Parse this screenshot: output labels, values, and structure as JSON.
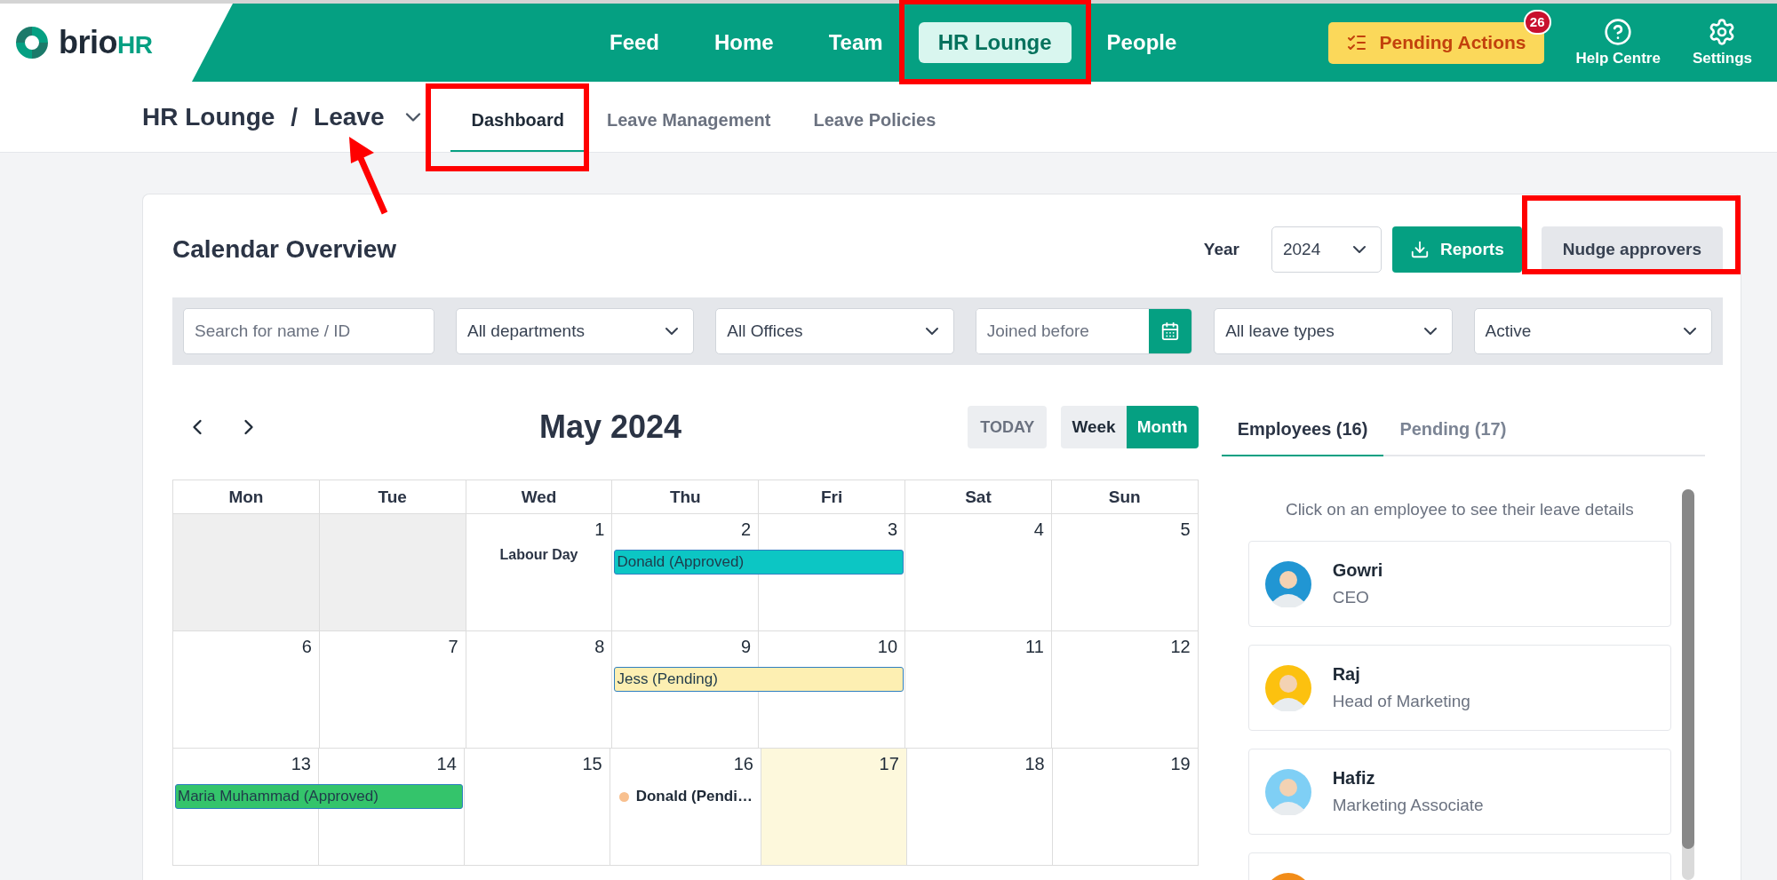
{
  "brand": {
    "name": "brio",
    "suffix": "HR"
  },
  "nav": [
    {
      "label": "Feed",
      "selected": false,
      "highlighted": false
    },
    {
      "label": "Home",
      "selected": false,
      "highlighted": false
    },
    {
      "label": "Team",
      "selected": false,
      "highlighted": false
    },
    {
      "label": "HR Lounge",
      "selected": true,
      "highlighted": true
    },
    {
      "label": "People",
      "selected": false,
      "highlighted": false
    }
  ],
  "pending_actions": {
    "label": "Pending Actions",
    "badge": "26"
  },
  "utilities": [
    {
      "label": "Help Centre",
      "kind": "help"
    },
    {
      "label": "Settings",
      "kind": "settings"
    }
  ],
  "breadcrumb": {
    "section": "HR Lounge",
    "separator": "/",
    "page": "Leave",
    "pointed_at": true
  },
  "subtabs": [
    {
      "label": "Dashboard",
      "selected": true,
      "highlighted": true
    },
    {
      "label": "Leave Management",
      "selected": false,
      "highlighted": false
    },
    {
      "label": "Leave Policies",
      "selected": false,
      "highlighted": false
    }
  ],
  "calendar_overview": {
    "title": "Calendar Overview",
    "year_label": "Year",
    "year": "2024",
    "reports_button": "Reports",
    "nudge_button": {
      "label": "Nudge approvers",
      "highlighted": true
    },
    "filters": [
      {
        "kind": "text",
        "placeholder": "Search for name / ID"
      },
      {
        "kind": "select",
        "value": "All departments"
      },
      {
        "kind": "select",
        "value": "All Offices"
      },
      {
        "kind": "date",
        "placeholder": "Joined before"
      },
      {
        "kind": "select",
        "value": "All leave types"
      },
      {
        "kind": "select",
        "value": "Active"
      }
    ],
    "month_title": "May 2024",
    "today_button": "TODAY",
    "views": [
      {
        "label": "Week",
        "selected": false
      },
      {
        "label": "Month",
        "selected": true
      }
    ],
    "weekdays": [
      "Mon",
      "Tue",
      "Wed",
      "Thu",
      "Fri",
      "Sat",
      "Sun"
    ],
    "weeks": [
      {
        "days": [
          {
            "outside": true,
            "today": false
          },
          {
            "outside": true,
            "today": false
          },
          {
            "number": "1",
            "outside": false,
            "today": false,
            "holiday": "Labour Day"
          },
          {
            "number": "2",
            "outside": false,
            "today": false,
            "event": {
              "kind": "bar",
              "label": "Donald (Approved)",
              "color": "#0cc6c4"
            }
          },
          {
            "number": "3",
            "outside": false,
            "today": false,
            "event_continues": true
          },
          {
            "number": "4",
            "outside": false,
            "today": false
          },
          {
            "number": "5",
            "outside": false,
            "today": false
          }
        ]
      },
      {
        "days": [
          {
            "number": "6",
            "outside": false,
            "today": false
          },
          {
            "number": "7",
            "outside": false,
            "today": false
          },
          {
            "number": "8",
            "outside": false,
            "today": false
          },
          {
            "number": "9",
            "outside": false,
            "today": false,
            "event": {
              "kind": "bar",
              "label": "Jess (Pending)",
              "color": "#fdefb2"
            }
          },
          {
            "number": "10",
            "outside": false,
            "today": false,
            "event_continues": true
          },
          {
            "number": "11",
            "outside": false,
            "today": false
          },
          {
            "number": "12",
            "outside": false,
            "today": false
          }
        ]
      },
      {
        "days": [
          {
            "number": "13",
            "outside": false,
            "today": false,
            "event": {
              "kind": "bar",
              "label": "Maria Muhammad (Approved)",
              "color": "#34c46b"
            }
          },
          {
            "number": "14",
            "outside": false,
            "today": false,
            "event_continues": true
          },
          {
            "number": "15",
            "outside": false,
            "today": false
          },
          {
            "number": "16",
            "outside": false,
            "today": false,
            "event": {
              "kind": "dot",
              "label": "Donald (Pendi…",
              "color": "#f8c08f"
            }
          },
          {
            "number": "17",
            "outside": false,
            "today": true
          },
          {
            "number": "18",
            "outside": false,
            "today": false
          },
          {
            "number": "19",
            "outside": false,
            "today": false
          }
        ]
      }
    ]
  },
  "panel_tabs": [
    {
      "label": "Employees (16)",
      "selected": true
    },
    {
      "label": "Pending (17)",
      "selected": false
    }
  ],
  "panel_hint": "Click on an employee to see their leave details",
  "employees": [
    {
      "name": "Gowri",
      "role": "CEO",
      "color": "#2196d3"
    },
    {
      "name": "Raj",
      "role": "Head of Marketing",
      "color": "#fcc10f"
    },
    {
      "name": "Hafiz",
      "role": "Marketing Associate",
      "color": "#7fcff5"
    },
    {
      "color": "#f28c18"
    }
  ]
}
